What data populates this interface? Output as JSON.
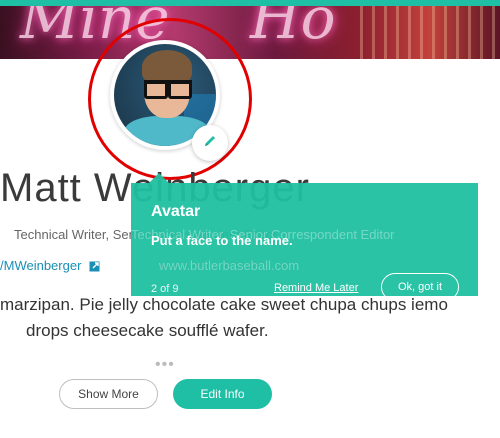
{
  "cover": {
    "neon_text_1": "Mine",
    "neon_text_2": "Ho"
  },
  "profile": {
    "name": "Matt Weinberger",
    "subtitle": "Technical Writer, Senior Correspondent Editor",
    "twitter": "/MWeinberger",
    "website": "www.butlerbaseball.com",
    "bio_line1": "marzipan. Pie jelly chocolate cake sweet chupa chups lemo",
    "bio_line2": "drops cheesecake soufflé wafer.",
    "more_dots": "•••",
    "show_more_label": "Show More",
    "edit_info_label": "Edit Info"
  },
  "tooltip": {
    "title": "Avatar",
    "body": "Put a face to the name.",
    "step": "2 of 9",
    "remind_label": "Remind Me Later",
    "ok_label": "Ok, got it"
  },
  "colors": {
    "accent": "#1fbfa6",
    "highlight": "#e00000",
    "link": "#1a8fb5"
  },
  "icons": {
    "edit_avatar": "pencil-icon",
    "external_link": "external-link-icon"
  }
}
